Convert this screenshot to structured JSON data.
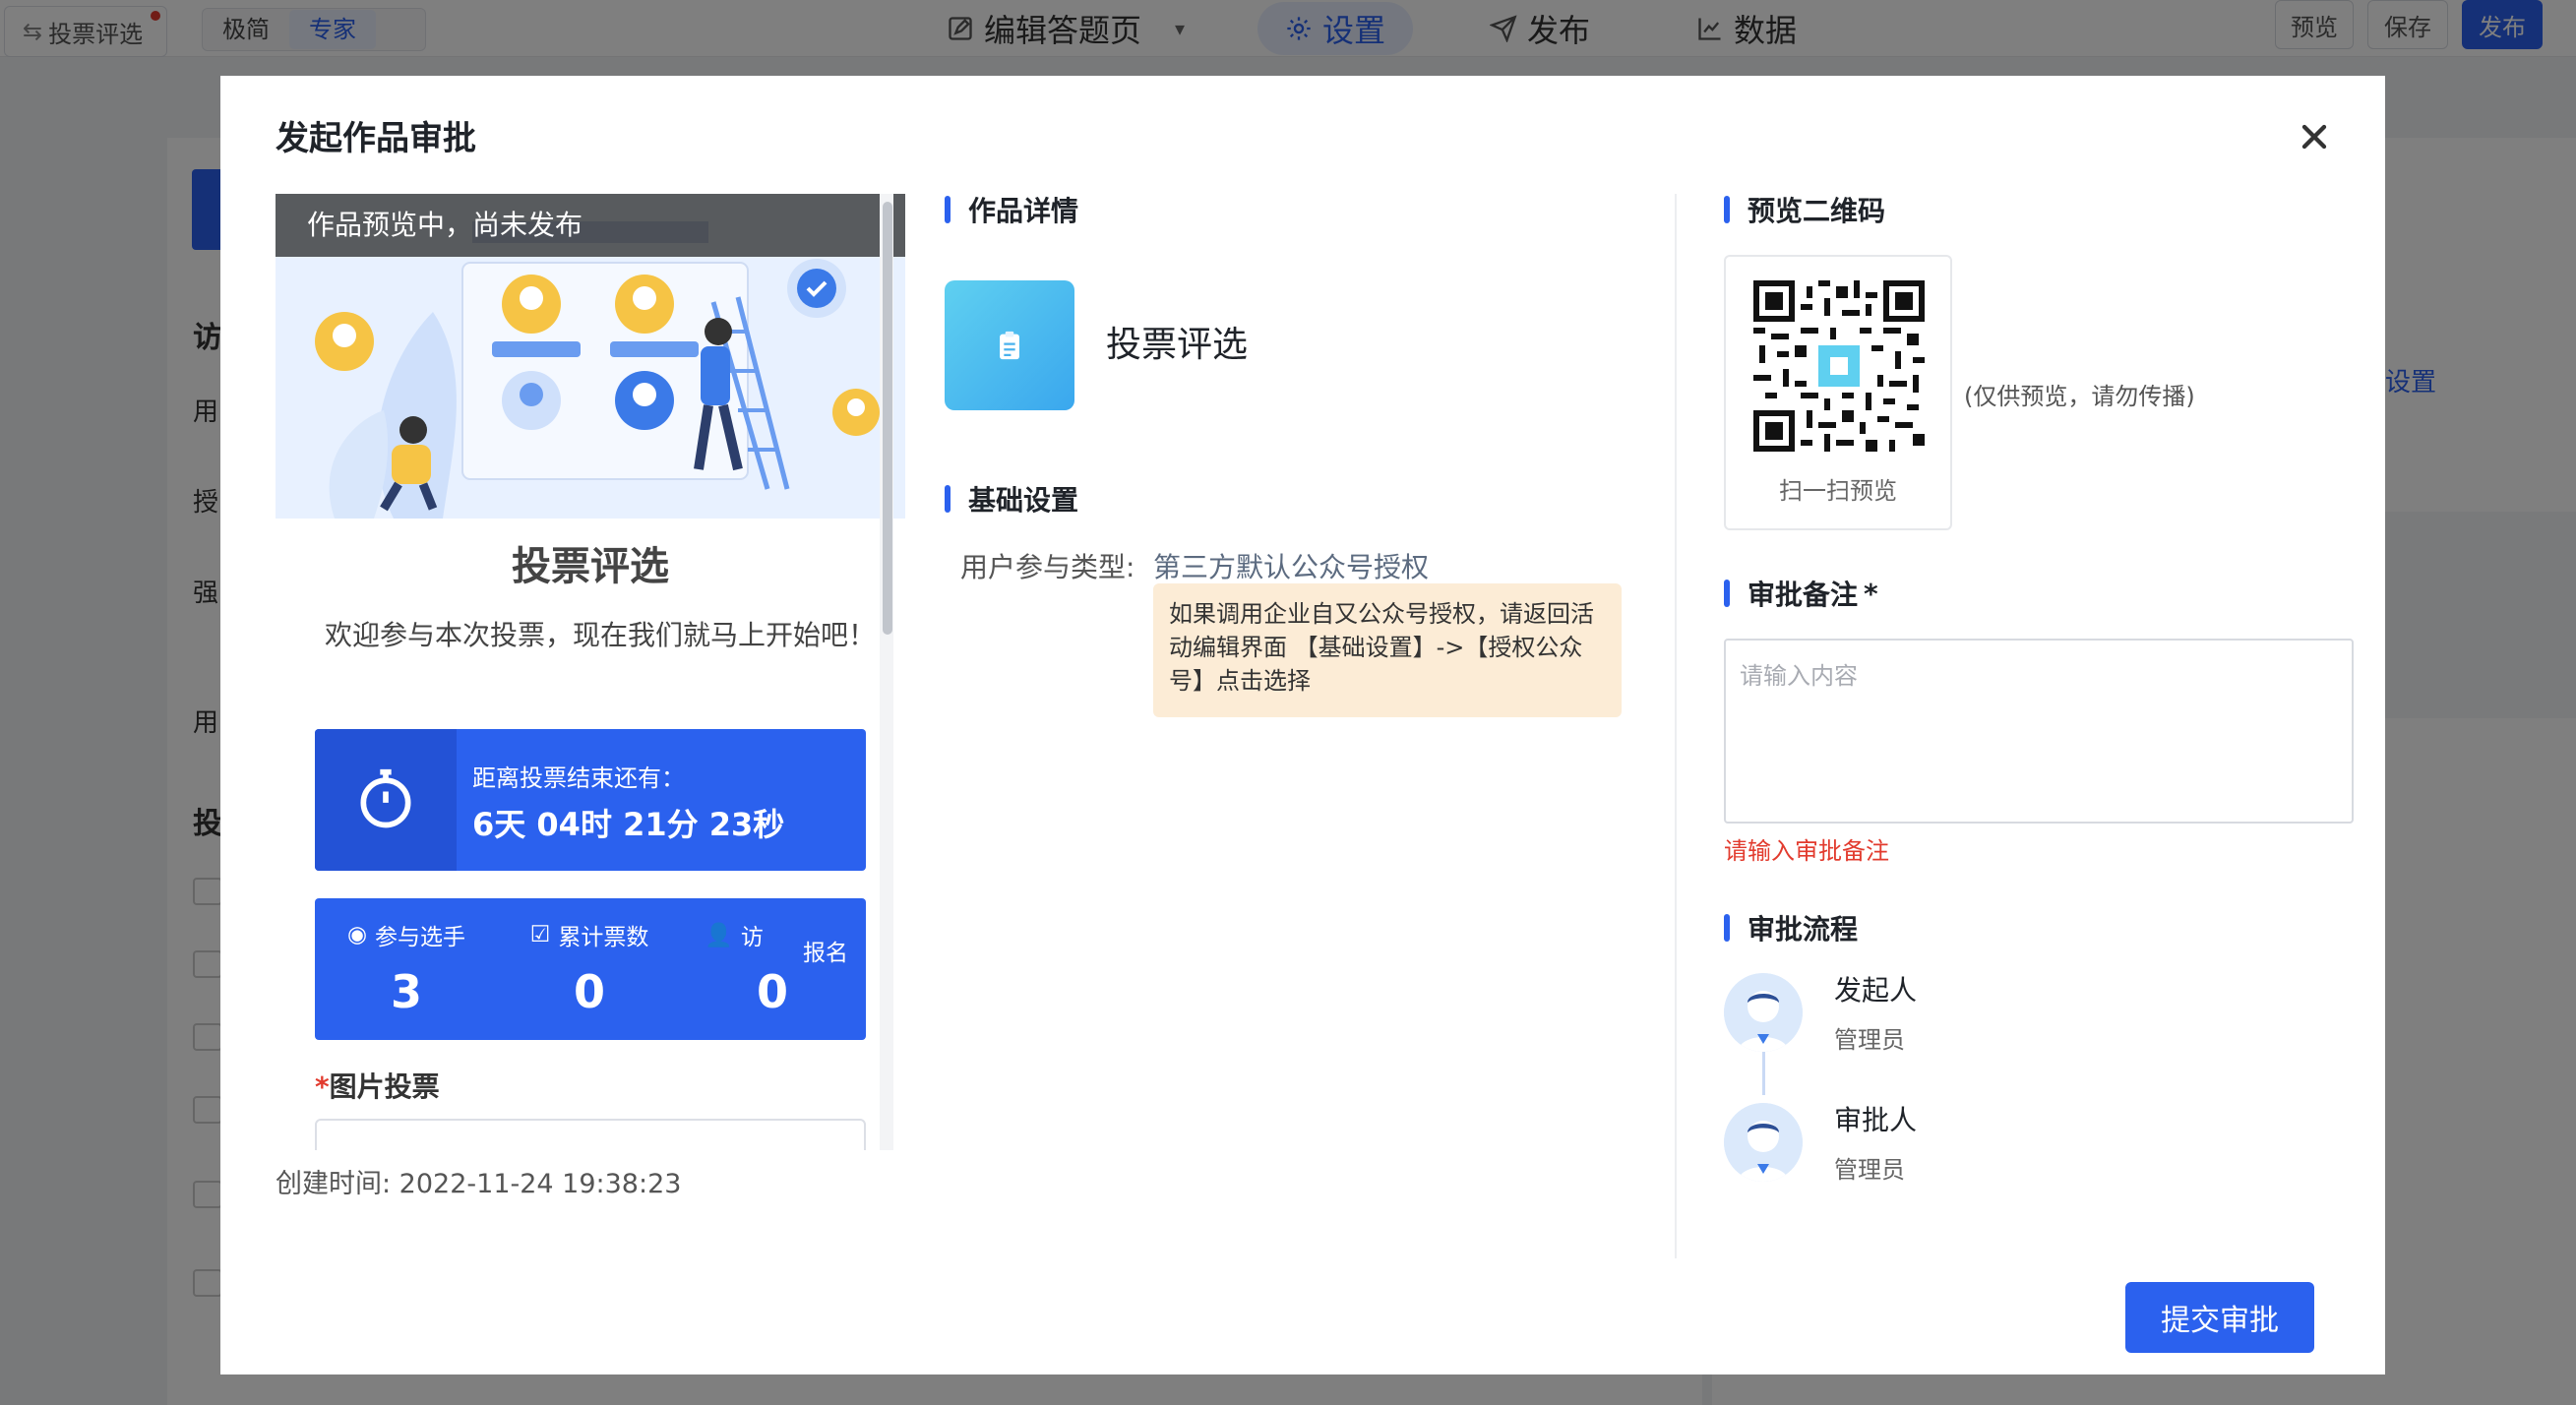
{
  "editor": {
    "back_label": "投票评选",
    "modes": [
      "极简",
      "专家"
    ],
    "nav": {
      "edit": "编辑答题页",
      "settings": "设置",
      "publish": "发布",
      "data": "数据"
    },
    "buttons": {
      "preview": "预览",
      "save": "保存",
      "publish": "发布"
    },
    "left_chars": [
      "访",
      "用",
      "授",
      "强",
      "用",
      "投"
    ],
    "right_link": "设置"
  },
  "modal": {
    "title": "发起作品审批",
    "preview": {
      "tip": "作品预览中，尚未发布",
      "title": "投票评选",
      "welcome": "欢迎参与本次投票，现在我们就马上开始吧！",
      "countdown_label": "距离投票结束还有：",
      "countdown_value": "6天 04时 21分 23秒",
      "stats": [
        {
          "label": "参与选手",
          "value": "3"
        },
        {
          "label": "累计票数",
          "value": "0"
        },
        {
          "label": "访",
          "value": "0"
        }
      ],
      "signup_label": "报名",
      "section_label": "图片投票"
    },
    "created_time": "创建时间: 2022-11-24 19:38:23",
    "details": {
      "heading": "作品详情",
      "work_name": "投票评选",
      "basic_heading": "基础设置",
      "field_label": "用户参与类型:",
      "field_value": "第三方默认公众号授权",
      "warning": "如果调用企业自又公众号授权，请返回活动编辑界面 【基础设置】->【授权公众号】点击选择"
    },
    "qr": {
      "heading": "预览二维码",
      "caption": "扫一扫预览",
      "note": "(仅供预览，请勿传播)"
    },
    "remark": {
      "heading": "审批备注",
      "required_mark": "*",
      "placeholder": "请输入内容",
      "error": "请输入审批备注"
    },
    "flow": {
      "heading": "审批流程",
      "steps": [
        {
          "role": "发起人",
          "user": "管理员"
        },
        {
          "role": "审批人",
          "user": "管理员"
        }
      ]
    },
    "submit_label": "提交审批"
  },
  "colors": {
    "accent": "#2b61ee",
    "error": "#e23b2e",
    "warning_bg": "#fcecd6"
  }
}
